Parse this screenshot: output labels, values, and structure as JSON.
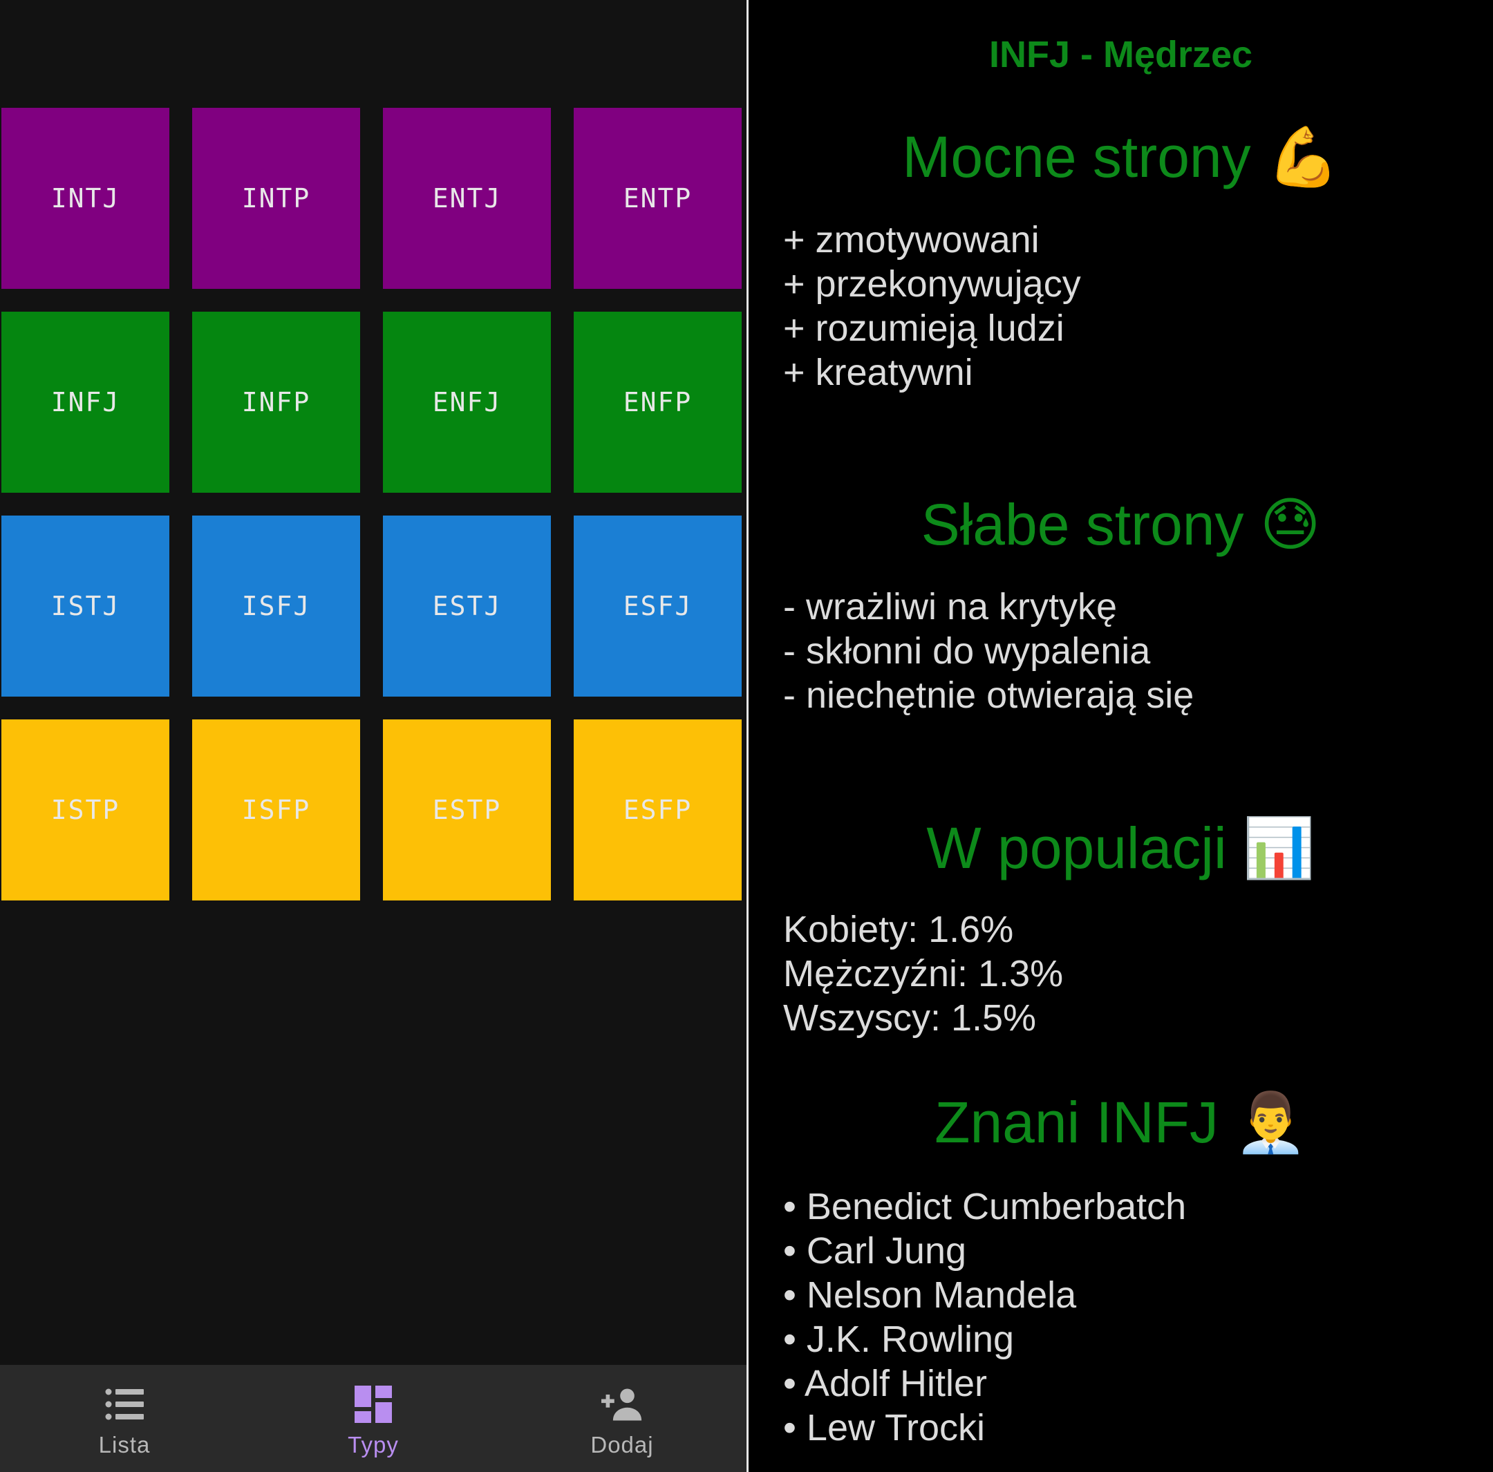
{
  "left_screen": {
    "tiles": [
      {
        "label": "INTJ",
        "color": "#800080"
      },
      {
        "label": "INTP",
        "color": "#800080"
      },
      {
        "label": "ENTJ",
        "color": "#800080"
      },
      {
        "label": "ENTP",
        "color": "#800080"
      },
      {
        "label": "INFJ",
        "color": "#058610"
      },
      {
        "label": "INFP",
        "color": "#058610"
      },
      {
        "label": "ENFJ",
        "color": "#058610"
      },
      {
        "label": "ENFP",
        "color": "#058610"
      },
      {
        "label": "ISTJ",
        "color": "#1b7fd4"
      },
      {
        "label": "ISFJ",
        "color": "#1b7fd4"
      },
      {
        "label": "ESTJ",
        "color": "#1b7fd4"
      },
      {
        "label": "ESFJ",
        "color": "#1b7fd4"
      },
      {
        "label": "ISTP",
        "color": "#fdc006"
      },
      {
        "label": "ISFP",
        "color": "#fdc006"
      },
      {
        "label": "ESTP",
        "color": "#fdc006"
      },
      {
        "label": "ESFP",
        "color": "#fdc006"
      }
    ],
    "bottom_nav": {
      "items": [
        {
          "label": "Lista",
          "icon": "list-icon",
          "active": false
        },
        {
          "label": "Typy",
          "icon": "dashboard-icon",
          "active": true
        },
        {
          "label": "Dodaj",
          "icon": "add-person-icon",
          "active": false
        }
      ],
      "active_color": "#b98ef0"
    }
  },
  "right_screen": {
    "title": "INFJ - Mędrzec",
    "accent_color": "#0d8a1a",
    "strengths": {
      "heading": "Mocne strony",
      "emoji": "💪",
      "items": [
        "+ zmotywowani",
        "+ przekonywujący",
        "+ rozumieją ludzi",
        "+ kreatywni"
      ]
    },
    "weaknesses": {
      "heading": "Słabe strony",
      "emoji": "😓",
      "items": [
        "- wrażliwi na krytykę",
        "- skłonni do wypalenia",
        "- niechętnie otwierają się"
      ]
    },
    "population": {
      "heading": "W populacji",
      "emoji": "📊",
      "items": [
        "Kobiety: 1.6%",
        "Mężczyźni: 1.3%",
        "Wszyscy: 1.5%"
      ]
    },
    "famous": {
      "heading": "Znani INFJ",
      "emoji": "👨‍💼",
      "items": [
        "• Benedict Cumberbatch",
        "• Carl Jung",
        "• Nelson Mandela",
        "• J.K. Rowling",
        "• Adolf Hitler",
        "• Lew Trocki"
      ]
    }
  }
}
